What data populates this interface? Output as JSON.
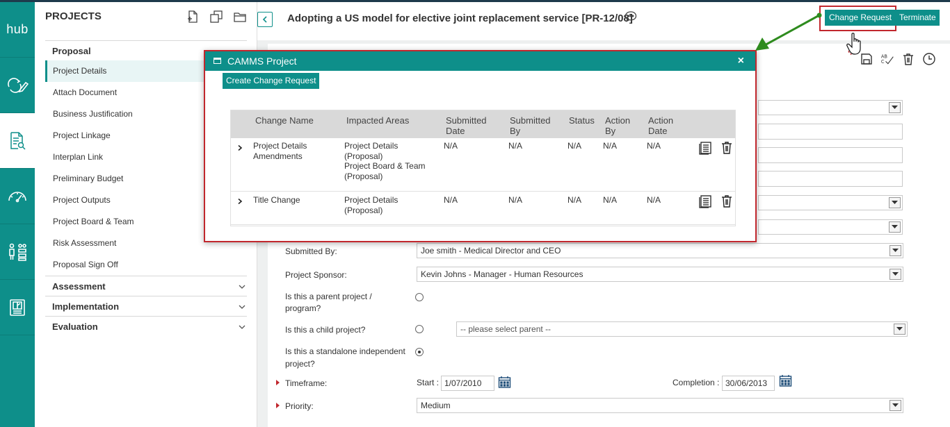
{
  "rail": {
    "logo": "hub",
    "items": [
      "sync-edit-icon",
      "document-search-icon",
      "gauge-icon",
      "people-chart-icon",
      "report-icon"
    ]
  },
  "sidebar": {
    "title": "PROJECTS",
    "proposal": {
      "label": "Proposal",
      "items": [
        "Project Details",
        "Attach Document",
        "Business Justification",
        "Project Linkage",
        "Interplan Link",
        "Preliminary Budget",
        "Project Outputs",
        "Project Board & Team",
        "Risk Assessment",
        "Proposal Sign Off"
      ]
    },
    "sections": [
      "Assessment",
      "Implementation",
      "Evaluation"
    ]
  },
  "header": {
    "title": "Adopting a US model for elective joint replacement service [PR-12/08]",
    "change_request": "Change Request",
    "terminate": "Terminate"
  },
  "form": {
    "submitted_by_label": "Submitted By:",
    "submitted_by_value": "Joe smith - Medical Director and CEO",
    "sponsor_label": "Project Sponsor:",
    "sponsor_value": "Kevin Johns - Manager - Human Resources",
    "parent_label": "Is this a parent project / program?",
    "child_label": "Is this a child project?",
    "parent_select_placeholder": "-- please select parent --",
    "standalone_label": "Is this a standalone independent project?",
    "timeframe_label": "Timeframe:",
    "start_label": "Start :",
    "start_value": "1/07/2010",
    "completion_label": "Completion :",
    "completion_value": "30/06/2013",
    "priority_label": "Priority:",
    "priority_value": "Medium"
  },
  "modal": {
    "title": "CAMMS Project",
    "close": "×",
    "create_button": "Create Change Request",
    "columns": {
      "change_name": "Change Name",
      "impacted_areas": "Impacted Areas",
      "submitted_date_1": "Submitted",
      "submitted_date_2": "Date",
      "submitted_by_1": "Submitted",
      "submitted_by_2": "By",
      "status": "Status",
      "action_by_1": "Action",
      "action_by_2": "By",
      "action_date_1": "Action",
      "action_date_2": "Date"
    },
    "rows": [
      {
        "name_1": "Project Details",
        "name_2": "Amendments",
        "areas": [
          "Project Details",
          "(Proposal)",
          "Project Board & Team",
          "(Proposal)"
        ],
        "submitted_date": "N/A",
        "submitted_by": "N/A",
        "status": "N/A",
        "action_by": "N/A",
        "action_date": "N/A"
      },
      {
        "name_1": "Title Change",
        "name_2": "",
        "areas": [
          "Project Details",
          "(Proposal)"
        ],
        "submitted_date": "N/A",
        "submitted_by": "N/A",
        "status": "N/A",
        "action_by": "N/A",
        "action_date": "N/A"
      }
    ]
  },
  "colors": {
    "teal": "#0e8f8a",
    "highlight_red": "#c1272d",
    "annotation_green": "#2e8b1e"
  }
}
